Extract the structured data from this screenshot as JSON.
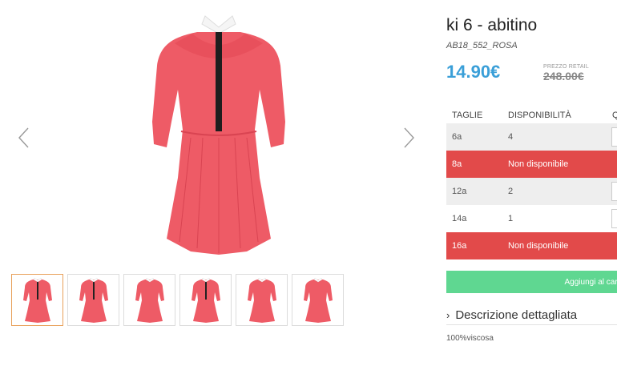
{
  "product": {
    "title": "ki 6 - abitino",
    "sku": "AB18_552_ROSA",
    "price": "14.90€",
    "retail_label": "PREZZO RETAIL",
    "retail_price": "248.00€",
    "colors": {
      "dress": "#ee5b66",
      "price": "#3a9fd8",
      "unavailable": "#e24a4a",
      "cart": "#5fd791"
    }
  },
  "table": {
    "headers": [
      "TAGLIE",
      "DISPONIBILITÀ",
      "Q"
    ],
    "rows": [
      {
        "size": "6a",
        "availability": "4",
        "status": "available"
      },
      {
        "size": "8a",
        "availability": "Non disponibile",
        "status": "unavailable"
      },
      {
        "size": "12a",
        "availability": "2",
        "status": "available"
      },
      {
        "size": "14a",
        "availability": "1",
        "status": "available"
      },
      {
        "size": "16a",
        "availability": "Non disponibile",
        "status": "unavailable"
      }
    ]
  },
  "cart_button": "Aggiungi al carr",
  "description": {
    "toggle": "Descrizione dettagliata",
    "chevron": "›",
    "text": "100%viscosa"
  },
  "gallery": {
    "prev_icon": "chevron-left-icon",
    "next_icon": "chevron-right-icon",
    "thumbnail_count": 6
  }
}
